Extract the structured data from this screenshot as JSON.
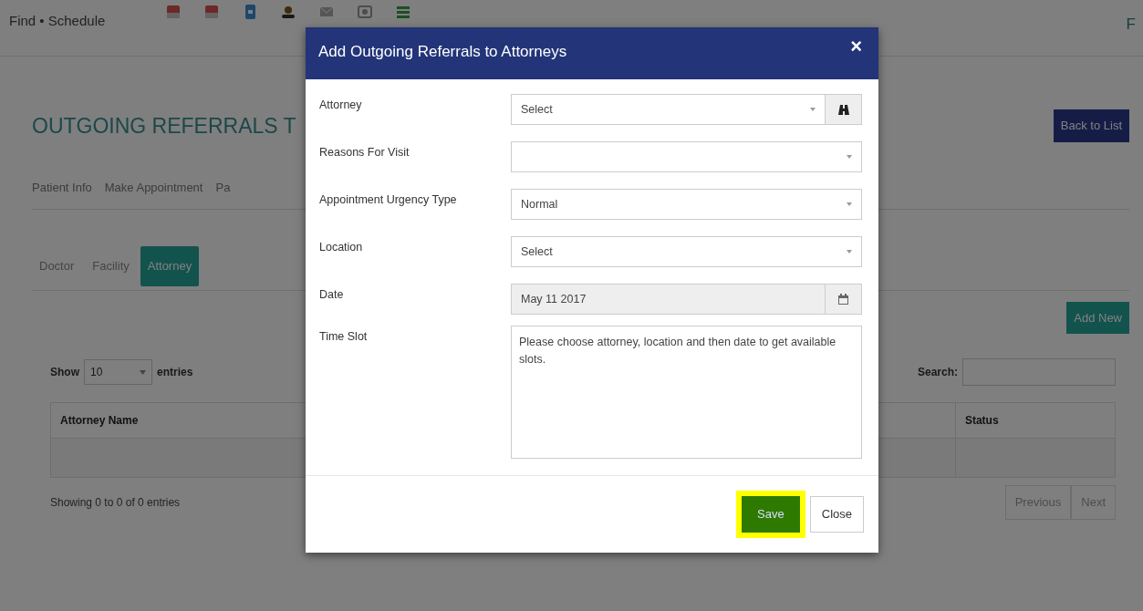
{
  "header": {
    "tagline": "Find • Schedule",
    "edge_text": "F"
  },
  "page": {
    "title": "OUTGOING REFERRALS T",
    "back_button": "Back to List",
    "nav_tabs": [
      {
        "label": "Patient Info"
      },
      {
        "label": "Make Appointment"
      },
      {
        "label": "Pa"
      }
    ],
    "sub_tabs": [
      {
        "label": "Doctor",
        "selected": false
      },
      {
        "label": "Facility",
        "selected": false
      },
      {
        "label": "Attorney",
        "selected": true
      }
    ],
    "add_button": "Add New",
    "length_menu": {
      "prefix": "Show",
      "value": "10",
      "suffix": "entries"
    },
    "search_label": "Search:",
    "table": {
      "columns": [
        "Attorney Name",
        "Status"
      ]
    },
    "info": "Showing 0 to 0 of 0 entries",
    "pagination": [
      "Previous",
      "Next"
    ]
  },
  "modal": {
    "title": "Add Outgoing Referrals to Attorneys",
    "close": "×",
    "fields": [
      {
        "label": "Attorney",
        "kind": "select",
        "value": "Select",
        "lookup": true
      },
      {
        "label": "Reasons For Visit",
        "kind": "select"
      },
      {
        "label": "Appointment Urgency Type",
        "kind": "select",
        "value": "Normal"
      },
      {
        "label": "Location",
        "kind": "select",
        "value": "Select"
      },
      {
        "label": "Date",
        "kind": "date",
        "value": "May 11 2017",
        "disabled": true
      },
      {
        "label": "Time Slot",
        "kind": "note",
        "text": "Please choose attorney, location and then date to get available slots."
      }
    ],
    "buttons": [
      {
        "label": "Save",
        "kind": "primary",
        "highlighted": true
      },
      {
        "label": "Close",
        "kind": "default",
        "highlighted": false
      }
    ]
  }
}
